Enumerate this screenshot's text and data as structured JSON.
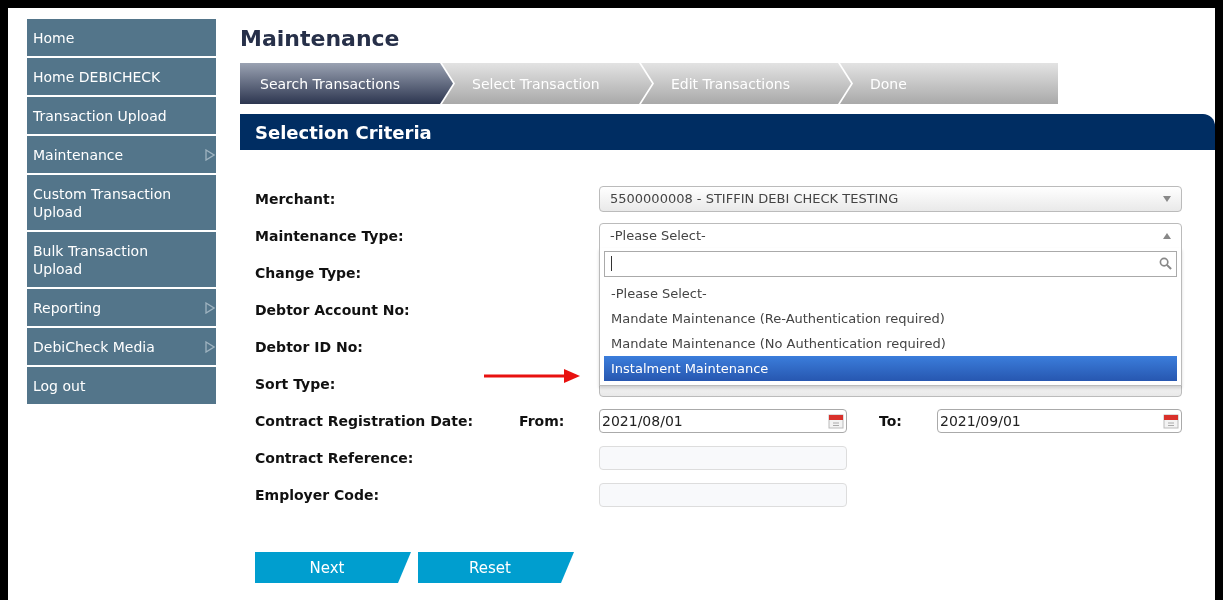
{
  "sidebar": {
    "items": [
      {
        "label": "Home",
        "has_submenu": false
      },
      {
        "label": "Home DEBICHECK",
        "has_submenu": false
      },
      {
        "label": "Transaction Upload",
        "has_submenu": false
      },
      {
        "label": "Maintenance",
        "has_submenu": true
      },
      {
        "label": "Custom Transaction Upload",
        "has_submenu": false
      },
      {
        "label": "Bulk Transaction Upload",
        "has_submenu": false
      },
      {
        "label": "Reporting",
        "has_submenu": true
      },
      {
        "label": "DebiCheck Media",
        "has_submenu": true
      },
      {
        "label": "Log out",
        "has_submenu": false
      }
    ]
  },
  "page_title": "Maintenance",
  "steps": [
    {
      "label": "Search Transactions",
      "selected": true
    },
    {
      "label": "Select Transaction",
      "selected": false
    },
    {
      "label": "Edit Transactions",
      "selected": false
    },
    {
      "label": "Done",
      "selected": false
    }
  ],
  "section_title": "Selection Criteria",
  "fields": [
    {
      "kind": "select",
      "label": "Merchant:",
      "value": "5500000008 - STIFFIN DEBI CHECK TESTING",
      "open": false
    },
    {
      "kind": "select",
      "label": "Maintenance Type:",
      "value": "-Please Select-",
      "open": true,
      "options": [
        {
          "label": "-Please Select-",
          "highlighted": false
        },
        {
          "label": "Mandate Maintenance (Re-Authentication required)",
          "highlighted": false
        },
        {
          "label": "Mandate Maintenance (No Authentication required)",
          "highlighted": false
        },
        {
          "label": "Instalment Maintenance",
          "highlighted": true
        }
      ]
    },
    {
      "kind": "covered",
      "label": "Change Type:"
    },
    {
      "kind": "covered",
      "label": "Debtor Account No:"
    },
    {
      "kind": "covered",
      "label": "Debtor ID No:"
    },
    {
      "kind": "covered_select",
      "label": "Sort Type:"
    },
    {
      "kind": "date_range",
      "label": "Contract Registration Date:",
      "from_label": "From:",
      "from_value": "2021/08/01",
      "to_label": "To:",
      "to_value": "2021/09/01"
    },
    {
      "kind": "text",
      "label": "Contract Reference:"
    },
    {
      "kind": "text",
      "label": "Employer Code:"
    }
  ],
  "buttons": [
    "Next",
    "Reset"
  ]
}
